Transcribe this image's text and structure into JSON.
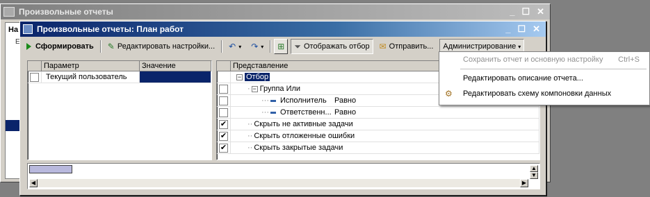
{
  "outer_window": {
    "title": "Произвольные отчеты",
    "controls": [
      "_",
      "☐",
      "✕"
    ],
    "list_header": "На",
    "list_row": "Е"
  },
  "inner_window": {
    "title": "Произвольные отчеты: План работ",
    "controls": [
      "_",
      "☐",
      "✕"
    ]
  },
  "toolbar": {
    "generate": "Сформировать",
    "edit_settings": "Редактировать настройки...",
    "show_filter": "Отображать отбор",
    "send": "Отправить...",
    "administration": "Администрирование"
  },
  "params_table": {
    "headers": [
      "Параметр",
      "Значение"
    ],
    "rows": [
      {
        "name": "Текущий пользователь",
        "checked": false
      }
    ]
  },
  "filter_tree": {
    "header": "Представление",
    "root": "Отбор",
    "group": "Группа Или",
    "items": [
      {
        "label": "Исполнитель",
        "op": "Равно",
        "checked": false
      },
      {
        "label": "Ответственн...",
        "op": "Равно",
        "checked": false
      }
    ],
    "filters": [
      {
        "label": "Скрыть не активные задачи",
        "checked": true
      },
      {
        "label": "Скрыть отложенные ошибки",
        "checked": true
      },
      {
        "label": "Скрыть закрытые задачи",
        "checked": true
      }
    ]
  },
  "admin_menu": {
    "items": [
      {
        "label": "Сохранить отчет и основную настройку",
        "shortcut": "Ctrl+S",
        "disabled": true
      },
      {
        "label": "Редактировать описание отчета...",
        "shortcut": "",
        "disabled": false
      },
      {
        "label": "Редактировать схему компоновки данных",
        "shortcut": "",
        "disabled": false
      }
    ]
  }
}
